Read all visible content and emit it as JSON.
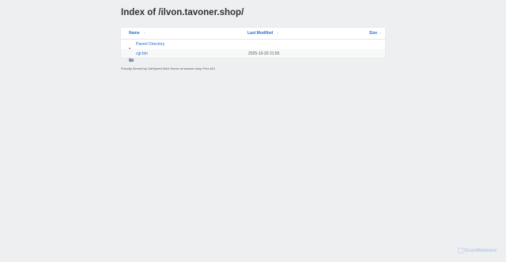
{
  "page": {
    "title": "Index of /ilvon.tavoner.shop/"
  },
  "table": {
    "headers": {
      "name": "Name",
      "modified": "Last Modified",
      "size": "Size",
      "sort_glyph": "↕"
    },
    "rows": [
      {
        "icon": "parent-directory-icon",
        "name": "Parent Directory",
        "modified": "",
        "size": ""
      },
      {
        "icon": "folder-icon",
        "name": "cgi-bin",
        "modified": "2025-10-20 21:55",
        "size": "-"
      }
    ]
  },
  "footer": {
    "text": "Proudly Served by LiteSpeed Web Server at tavoner.shop Port 443"
  },
  "watermark": {
    "text": "ScanMalware",
    "logo_text": "S"
  },
  "colors": {
    "background": "#eeeff0",
    "link": "#2a6fc9",
    "panel": "#ffffff",
    "watermark": "#b9cbe4"
  }
}
